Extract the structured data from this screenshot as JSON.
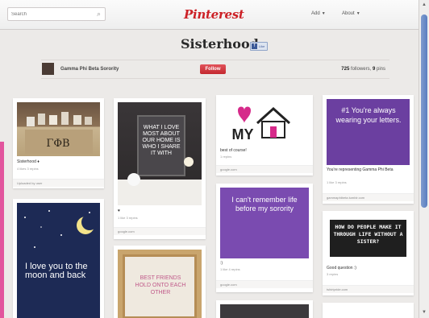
{
  "header": {
    "search_placeholder": "Search",
    "logo": "Pinterest",
    "add_label": "Add",
    "about_label": "About"
  },
  "board": {
    "title": "Sisterhood",
    "edit_label": "Like",
    "owner": "Gamma Phi Beta Sorority",
    "follow_label": "Follow",
    "followers_count": "725",
    "followers_label": "followers,",
    "pins_count": "9",
    "pins_label": "pins"
  },
  "pins": [
    {
      "desc": "Sisterhood ♦",
      "meta": "4 likes 3 repins",
      "src": "Uploaded by user",
      "image_text": "ΓΦB"
    },
    {
      "desc": "I love you to the moon and back",
      "meta": "",
      "src": "",
      "image_text": "I love you to the moon and back"
    },
    {
      "desc": "♥",
      "meta": "1 like 3 repins",
      "src": "google.com",
      "image_text": "WHAT I LOVE MOST ABOUT OUR HOME IS WHO I SHARE IT WITH"
    },
    {
      "desc": "",
      "meta": "",
      "src": "",
      "image_text": "BEST FRIENDS HOLD ONTO EACH OTHER"
    },
    {
      "desc": "best of course!",
      "meta": "1 repins",
      "src": "google.com",
      "image_text": "MY"
    },
    {
      "desc": ":)",
      "meta": "1 like 4 repins",
      "src": "google.com",
      "image_text": "I can't remember life before my sorority"
    },
    {
      "desc": "You're representing Gamma Phi Beta",
      "meta": "1 like 3 repins",
      "src": "gammaphibeta.tumblr.com",
      "image_text": "#1 You're always wearing your letters."
    },
    {
      "desc": "Good question :)",
      "meta": "3 repins",
      "src": "tshirtpride.com",
      "image_text": "HOW DO PEOPLE MAKE IT THROUGH LIFE WITHOUT A SISTER?"
    }
  ],
  "colors": {
    "brand": "#cc2127",
    "purple": "#6b3fa0",
    "navy": "#1d2a55",
    "scroll": "#5a7fc0"
  }
}
